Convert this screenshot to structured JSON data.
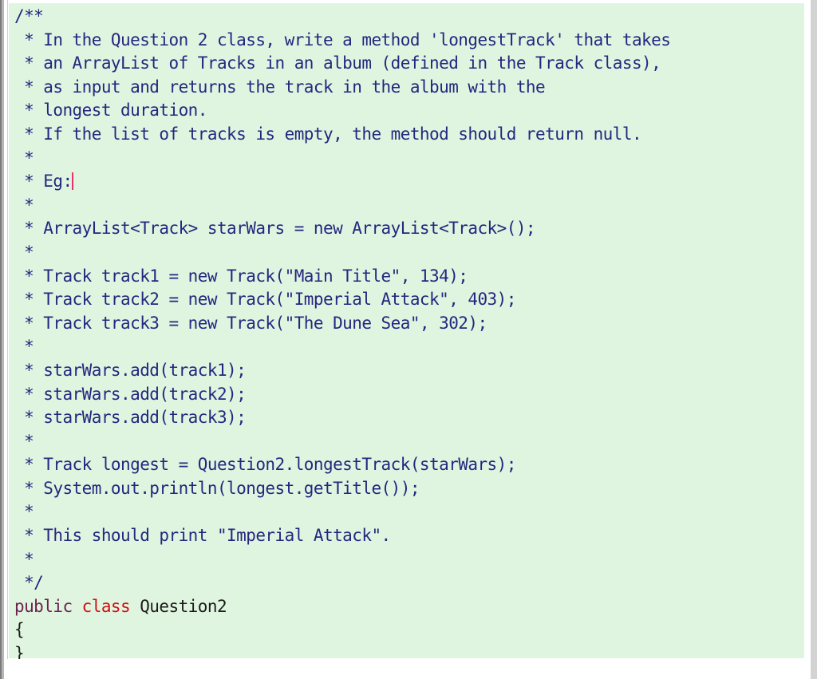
{
  "editor": {
    "title": "Question2",
    "language": "Java",
    "colors": {
      "background": "#e0f5e0",
      "comment": "#26267f",
      "modifier_keyword": "#6b2250",
      "keyword": "#d01010",
      "plain": "#1a1a1a",
      "caret": "#e8336d",
      "window_frame": "#d3d3d3",
      "page_background": "#ffffff"
    },
    "caret": {
      "line_index": 7,
      "after_text": " * Eg:"
    },
    "lines": [
      {
        "index": 0,
        "type": "comment",
        "text": "/**"
      },
      {
        "index": 1,
        "type": "comment",
        "text": " * In the Question 2 class, write a method 'longestTrack' that takes"
      },
      {
        "index": 2,
        "type": "comment",
        "text": " * an ArrayList of Tracks in an album (defined in the Track class),"
      },
      {
        "index": 3,
        "type": "comment",
        "text": " * as input and returns the track in the album with the"
      },
      {
        "index": 4,
        "type": "comment",
        "text": " * longest duration."
      },
      {
        "index": 5,
        "type": "comment",
        "text": " * If the list of tracks is empty, the method should return null."
      },
      {
        "index": 6,
        "type": "comment",
        "text": " *"
      },
      {
        "index": 7,
        "type": "comment",
        "text": " * Eg:",
        "has_caret": true
      },
      {
        "index": 8,
        "type": "comment",
        "text": " *"
      },
      {
        "index": 9,
        "type": "comment",
        "text": " * ArrayList<Track> starWars = new ArrayList<Track>();"
      },
      {
        "index": 10,
        "type": "comment",
        "text": " *"
      },
      {
        "index": 11,
        "type": "comment",
        "text": " * Track track1 = new Track(\"Main Title\", 134);"
      },
      {
        "index": 12,
        "type": "comment",
        "text": " * Track track2 = new Track(\"Imperial Attack\", 403);"
      },
      {
        "index": 13,
        "type": "comment",
        "text": " * Track track3 = new Track(\"The Dune Sea\", 302);"
      },
      {
        "index": 14,
        "type": "comment",
        "text": " *"
      },
      {
        "index": 15,
        "type": "comment",
        "text": " * starWars.add(track1);"
      },
      {
        "index": 16,
        "type": "comment",
        "text": " * starWars.add(track2);"
      },
      {
        "index": 17,
        "type": "comment",
        "text": " * starWars.add(track3);"
      },
      {
        "index": 18,
        "type": "comment",
        "text": " *"
      },
      {
        "index": 19,
        "type": "comment",
        "text": " * Track longest = Question2.longestTrack(starWars);"
      },
      {
        "index": 20,
        "type": "comment",
        "text": " * System.out.println(longest.getTitle());"
      },
      {
        "index": 21,
        "type": "comment",
        "text": " *"
      },
      {
        "index": 22,
        "type": "comment",
        "text": " * This should print \"Imperial Attack\"."
      },
      {
        "index": 23,
        "type": "comment",
        "text": " *"
      },
      {
        "index": 24,
        "type": "comment",
        "text": " */"
      },
      {
        "index": 25,
        "type": "code",
        "tokens": [
          {
            "kind": "modifier",
            "text": "public"
          },
          {
            "kind": "plain",
            "text": " "
          },
          {
            "kind": "keyword",
            "text": "class"
          },
          {
            "kind": "plain",
            "text": " Question2"
          }
        ]
      },
      {
        "index": 26,
        "type": "code",
        "tokens": [
          {
            "kind": "plain",
            "text": "{"
          }
        ]
      },
      {
        "index": 27,
        "type": "code",
        "tokens": [
          {
            "kind": "plain",
            "text": "}"
          }
        ]
      }
    ]
  }
}
